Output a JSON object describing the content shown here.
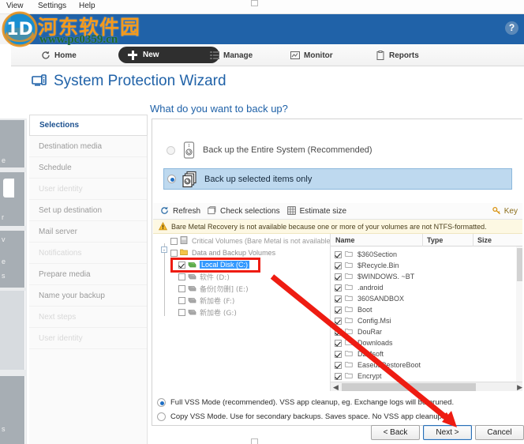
{
  "window": {
    "menu": [
      "View",
      "Settings",
      "Help"
    ],
    "help_button": "?"
  },
  "watermark": {
    "site_name": "河东软件园",
    "url": "www.pc0359.cn"
  },
  "nav": {
    "items": [
      {
        "label": "Home",
        "icon": "home-refresh-icon"
      },
      {
        "label": "New",
        "icon": "plus-icon"
      },
      {
        "label": "Manage",
        "icon": "list-icon"
      },
      {
        "label": "Monitor",
        "icon": "monitor-icon"
      },
      {
        "label": "Reports",
        "icon": "clipboard-icon"
      }
    ]
  },
  "wizard": {
    "title": "System Protection Wizard",
    "icon": "computer-wizard-icon",
    "question": "What do you want to back up?"
  },
  "steps": [
    {
      "label": "Selections",
      "state": "active"
    },
    {
      "label": "Destination media",
      "state": "enabled"
    },
    {
      "label": "Schedule",
      "state": "enabled"
    },
    {
      "label": "User identity",
      "state": "faint"
    },
    {
      "label": "Set up destination",
      "state": "enabled"
    },
    {
      "label": "Mail server",
      "state": "enabled"
    },
    {
      "label": "Notifications",
      "state": "faint"
    },
    {
      "label": "Prepare media",
      "state": "enabled"
    },
    {
      "label": "Name your backup",
      "state": "enabled"
    },
    {
      "label": "Next steps",
      "state": "faint"
    },
    {
      "label": "User identity",
      "state": "faint"
    }
  ],
  "backup_mode": {
    "option_entire": "Back up the Entire System (Recommended)",
    "option_selected": "Back up selected items only",
    "selected": "option_selected"
  },
  "toolbar": {
    "refresh": "Refresh",
    "check_selections": "Check selections",
    "estimate_size": "Estimate size",
    "key": "Key"
  },
  "warning": {
    "text": "Bare Metal Recovery is not available because one or more of your volumes are not NTFS-formatted."
  },
  "tree": [
    {
      "label": "Critical Volumes (Bare Metal is not available)",
      "checked": false,
      "level": 1,
      "icon": "volume-icon",
      "selected": false
    },
    {
      "label": "Data and Backup Volumes",
      "checked": false,
      "level": 1,
      "icon": "folder-icon",
      "selected": false
    },
    {
      "label": "Local Disk (C:)",
      "checked": true,
      "level": 2,
      "icon": "drive-icon",
      "selected": true
    },
    {
      "label": "软件 (D:)",
      "checked": false,
      "level": 2,
      "icon": "drive-icon",
      "selected": false
    },
    {
      "label": "备份[勿删] (E:)",
      "checked": false,
      "level": 2,
      "icon": "drive-icon",
      "selected": false
    },
    {
      "label": "新加卷 (F:)",
      "checked": false,
      "level": 2,
      "icon": "drive-icon",
      "selected": false
    },
    {
      "label": "新加卷 (G:)",
      "checked": false,
      "level": 2,
      "icon": "drive-icon",
      "selected": false
    }
  ],
  "file_list": {
    "columns": [
      "Name",
      "Type",
      "Size"
    ],
    "rows": [
      {
        "name": "$360Section",
        "type": "",
        "size": "",
        "checked": true
      },
      {
        "name": "$Recycle.Bin",
        "type": "",
        "size": "",
        "checked": true
      },
      {
        "name": "$WINDOWS. ~BT",
        "type": "",
        "size": "",
        "checked": true
      },
      {
        "name": ".android",
        "type": "",
        "size": "",
        "checked": true
      },
      {
        "name": "360SANDBOX",
        "type": "",
        "size": "",
        "checked": true
      },
      {
        "name": "Boot",
        "type": "",
        "size": "",
        "checked": true
      },
      {
        "name": "Config.Msi",
        "type": "",
        "size": "",
        "checked": true
      },
      {
        "name": "DouRar",
        "type": "",
        "size": "",
        "checked": true
      },
      {
        "name": "Downloads",
        "type": "",
        "size": "",
        "checked": true
      },
      {
        "name": "DzMsoft",
        "type": "",
        "size": "",
        "checked": true
      },
      {
        "name": "EaseusRestoreBoot",
        "type": "",
        "size": "",
        "checked": true
      },
      {
        "name": "Encrypt",
        "type": "",
        "size": "",
        "checked": true
      }
    ]
  },
  "vss": {
    "full_label": "Full VSS Mode (recommended). VSS app cleanup, eg. Exchange logs will be pruned.",
    "copy_label": "Copy VSS Mode. Use for secondary backups. Saves space. No VSS app cleanup.",
    "selected": "full"
  },
  "buttons": {
    "back": "< Back",
    "next": "Next >",
    "cancel": "Cancel"
  },
  "rail": {
    "fragments": [
      "e",
      "r",
      "v",
      "e",
      "s"
    ]
  },
  "colors": {
    "brand_blue": "#2062a8",
    "highlight_blue": "#bed9ef",
    "selection_blue": "#3399ff",
    "warning_bg": "#fdf8e3",
    "annotation_red": "#ee1c12",
    "watermark_orange": "#f59a1b",
    "watermark_green": "#1f6b2e"
  }
}
